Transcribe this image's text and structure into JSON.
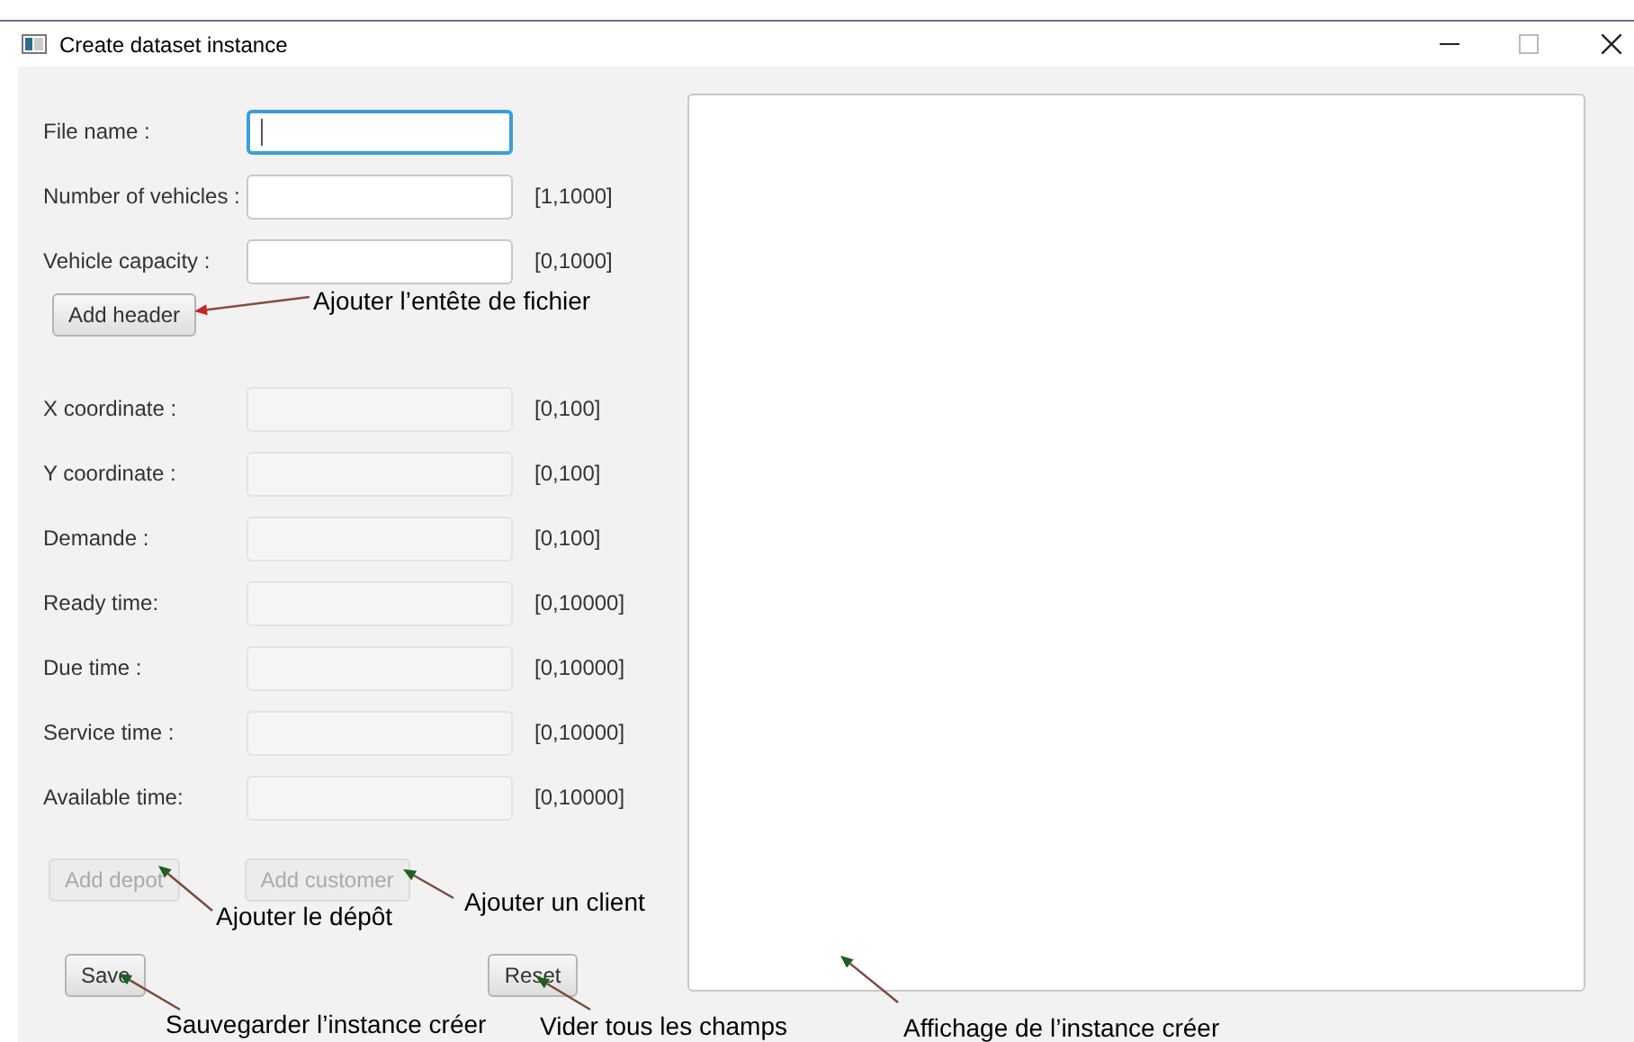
{
  "window": {
    "title": "Create dataset instance"
  },
  "header_fields": [
    {
      "label": "File name :",
      "focused": true,
      "disabled": false
    },
    {
      "label": "Number of vehicles :",
      "focused": false,
      "disabled": false,
      "range": "[1,1000]"
    },
    {
      "label": "Vehicle capacity :",
      "focused": false,
      "disabled": false,
      "range": "[0,1000]"
    }
  ],
  "add_header_button": {
    "label": "Add header",
    "disabled": false
  },
  "point_fields": [
    {
      "label": "X coordinate :",
      "disabled": true,
      "range": "[0,100]"
    },
    {
      "label": "Y coordinate :",
      "disabled": true,
      "range": "[0,100]"
    },
    {
      "label": "Demande :",
      "disabled": true,
      "range": "[0,100]"
    },
    {
      "label": "Ready time:",
      "disabled": true,
      "range": "[0,10000]"
    },
    {
      "label": "Due time :",
      "disabled": true,
      "range": "[0,10000]"
    },
    {
      "label": "Service time :",
      "disabled": true,
      "range": "[0,10000]"
    },
    {
      "label": "Available time:",
      "disabled": true,
      "range": "[0,10000]"
    }
  ],
  "add_buttons": [
    {
      "label": "Add depot",
      "disabled": true
    },
    {
      "label": "Add customer",
      "disabled": true
    }
  ],
  "action_buttons": [
    {
      "label": "Save",
      "disabled": false
    },
    {
      "label": "Reset",
      "disabled": false
    }
  ],
  "annotations": [
    {
      "text": "Ajouter l’entête de fichier"
    },
    {
      "text": "Ajouter le dépôt"
    },
    {
      "text": "Ajouter un client"
    },
    {
      "text": "Sauvegarder l’instance créer"
    },
    {
      "text": "Vider tous les champs"
    },
    {
      "text": "Affichage de l’instance créer"
    }
  ]
}
